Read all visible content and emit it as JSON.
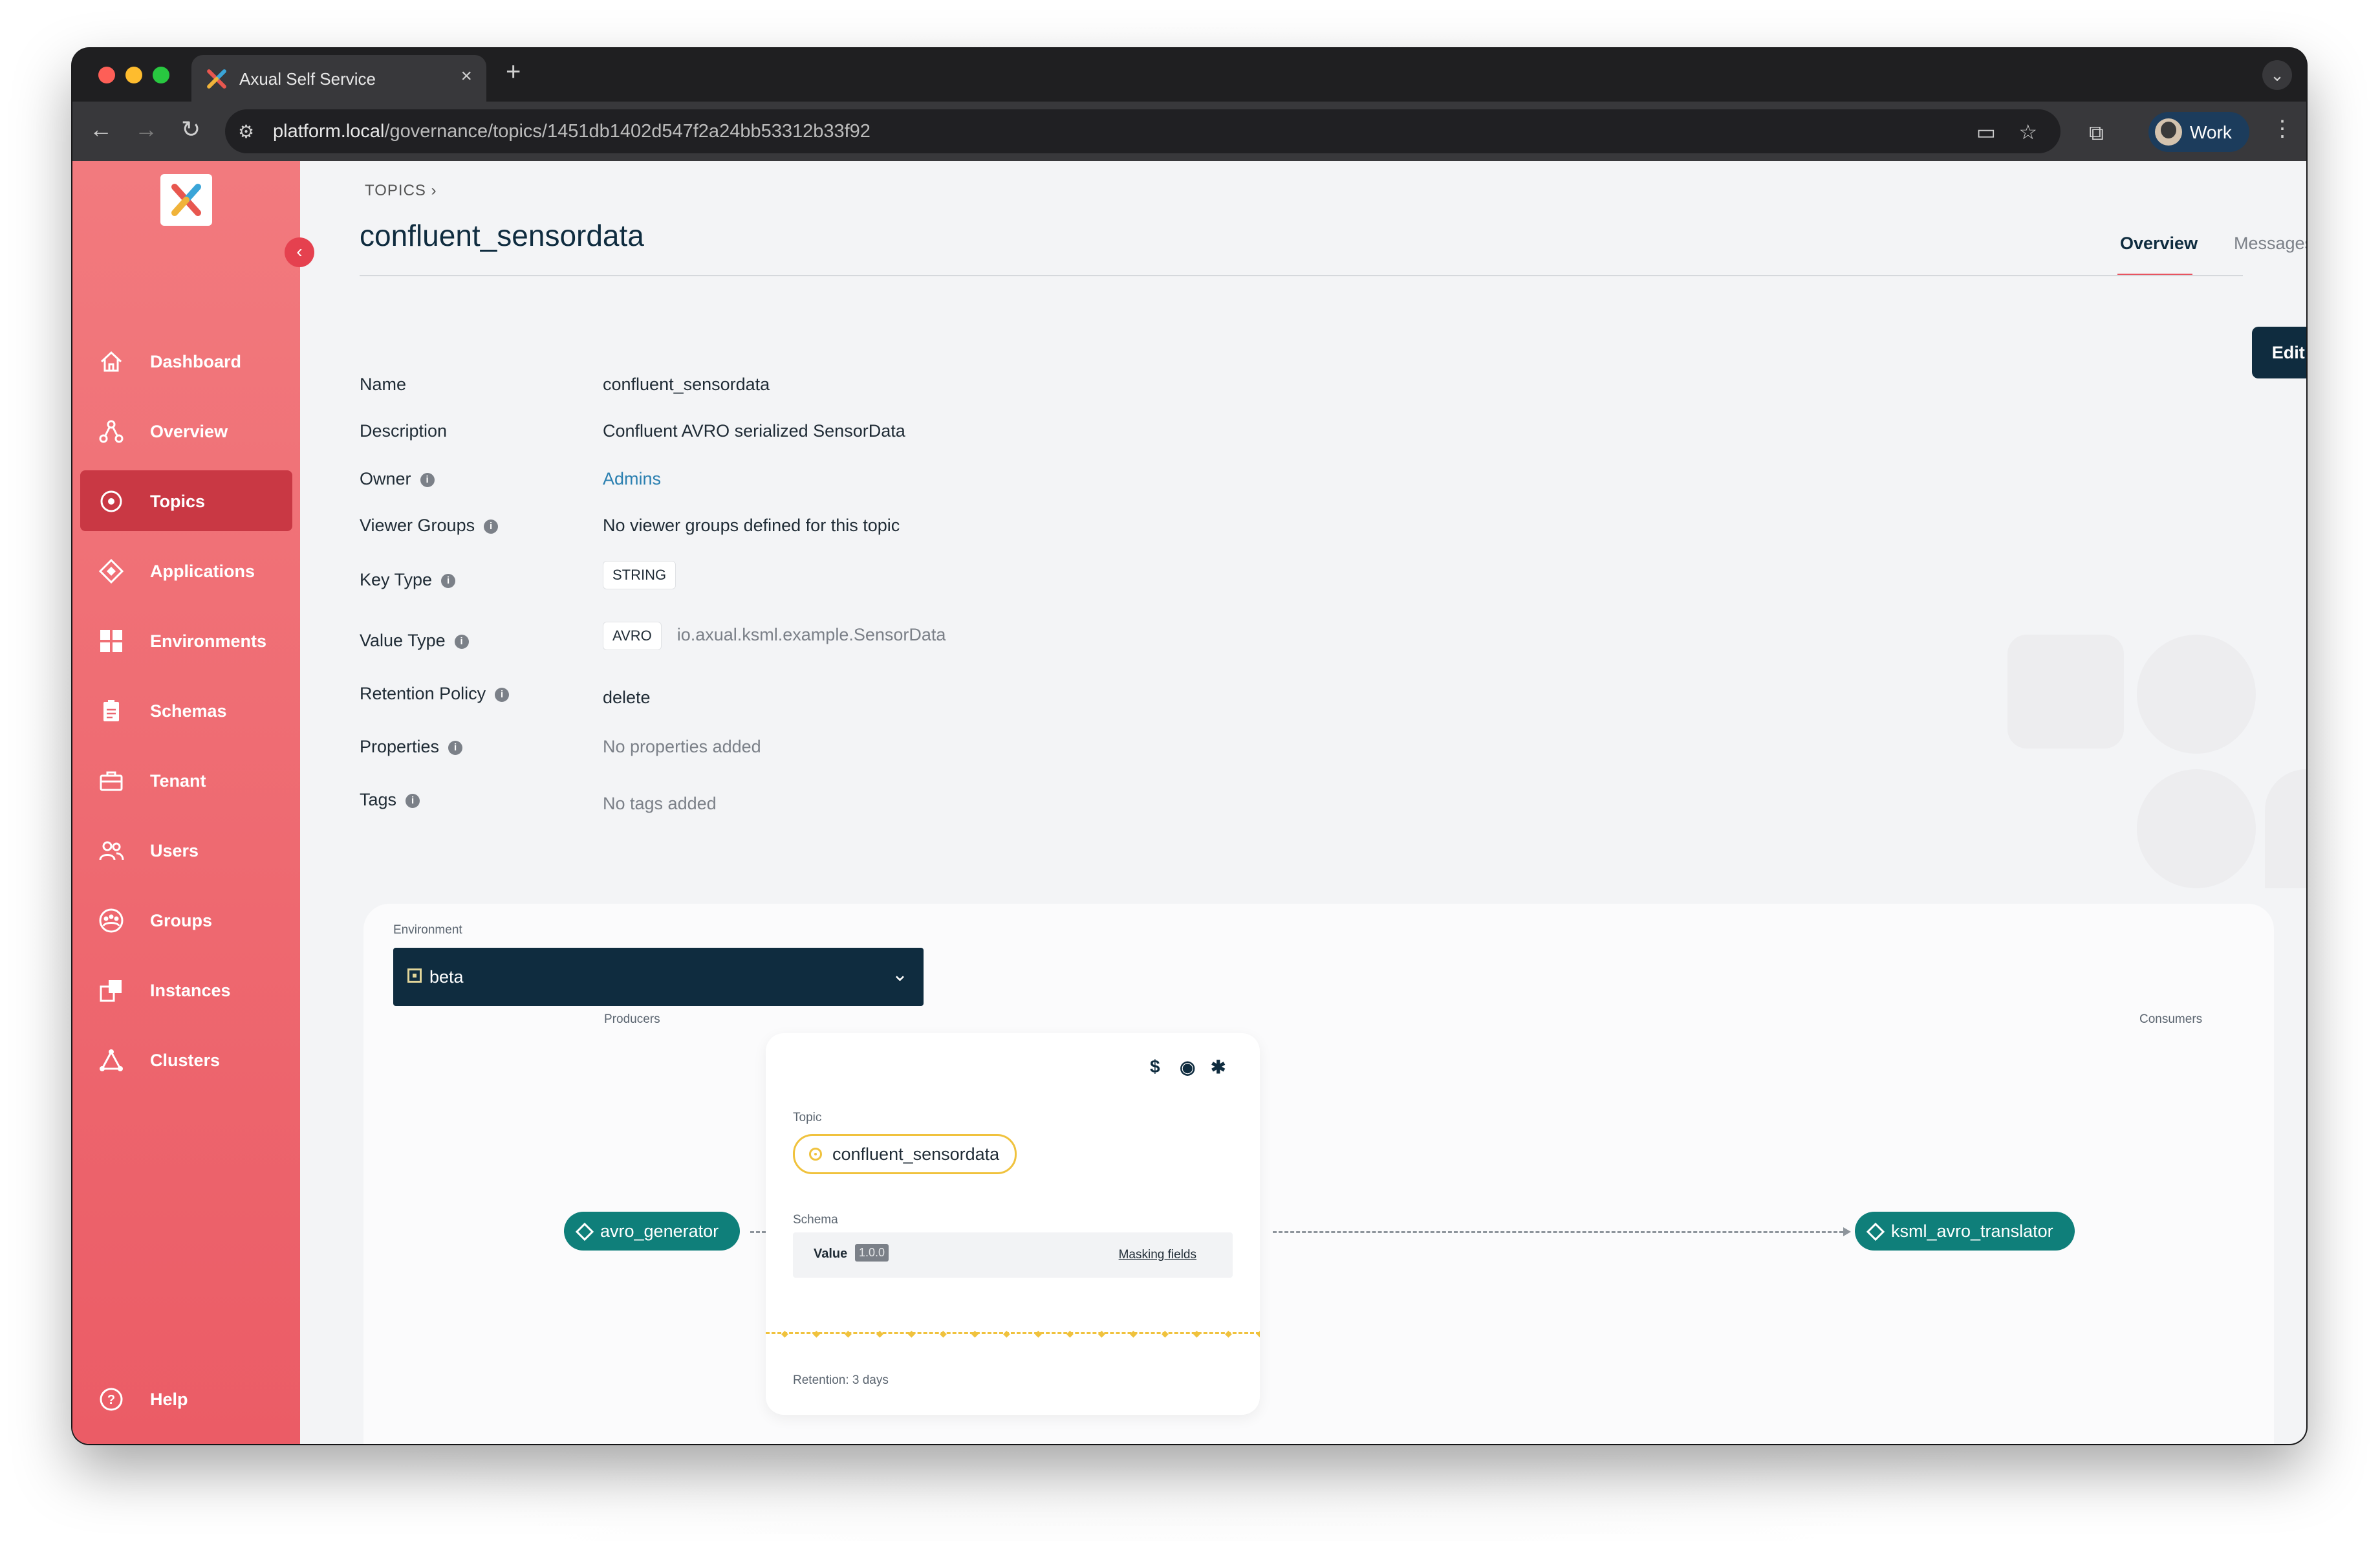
{
  "browser": {
    "tab_title": "Axual Self Service",
    "tab_close": "×",
    "new_tab": "+",
    "tab_menu": "⌄",
    "url_host": "platform.local",
    "url_path": "/governance/topics/1451db1402d547f2a24bb53312b33f92",
    "profile_name": "Work"
  },
  "sidebar": {
    "items": [
      {
        "label": "Dashboard",
        "icon": "home-icon"
      },
      {
        "label": "Overview",
        "icon": "overview-icon"
      },
      {
        "label": "Topics",
        "icon": "topic-icon",
        "active": true
      },
      {
        "label": "Applications",
        "icon": "application-icon"
      },
      {
        "label": "Environments",
        "icon": "environment-icon"
      },
      {
        "label": "Schemas",
        "icon": "schema-icon"
      },
      {
        "label": "Tenant",
        "icon": "tenant-icon"
      },
      {
        "label": "Users",
        "icon": "users-icon"
      },
      {
        "label": "Groups",
        "icon": "groups-icon"
      },
      {
        "label": "Instances",
        "icon": "instances-icon"
      },
      {
        "label": "Clusters",
        "icon": "clusters-icon"
      }
    ],
    "help_label": "Help",
    "colors": {
      "top": "#f27a7e",
      "bottom": "#eb5c66",
      "active": "#c93844"
    }
  },
  "header": {
    "breadcrumb": "TOPICS",
    "breadcrumb_chevron": "›",
    "title": "confluent_sensordata",
    "tabs": [
      "Overview",
      "Messages"
    ],
    "active_tab": "Overview"
  },
  "properties": {
    "name_label": "Name",
    "name_value": "confluent_sensordata",
    "description_label": "Description",
    "description_value": "Confluent AVRO serialized SensorData",
    "owner_label": "Owner",
    "owner_value": "Admins",
    "viewer_groups_label": "Viewer Groups",
    "viewer_groups_value": "No viewer groups defined for this topic",
    "key_type_label": "Key Type",
    "key_type_value": "STRING",
    "value_type_label": "Value Type",
    "value_type_value": "AVRO",
    "value_type_schema": "io.axual.ksml.example.SensorData",
    "retention_label": "Retention Policy",
    "retention_value": "delete",
    "properties_label": "Properties",
    "properties_value": "No properties added",
    "tags_label": "Tags",
    "tags_value": "No tags added",
    "info_glyph": "i"
  },
  "actions": {
    "edit_topic": "Edit Topic"
  },
  "lineage": {
    "environment_label": "Environment",
    "environment_value": "beta",
    "chevron": "⌄",
    "producers_label": "Producers",
    "consumers_label": "Consumers",
    "producer": "avro_generator",
    "consumer": "ksml_avro_translator",
    "card": {
      "tool_dollar": "$",
      "tool_eye": "◉",
      "tool_gear": "✱",
      "topic_label": "Topic",
      "topic_name": "confluent_sensordata",
      "schema_label": "Schema",
      "schema_value": "Value",
      "schema_version": "1.0.0",
      "masking": "Masking fields",
      "retention": "Retention: 3 days"
    },
    "colors": {
      "node": "#0f7f7a",
      "topic": "#f0c23d",
      "panel": "#0f2c3f"
    }
  }
}
